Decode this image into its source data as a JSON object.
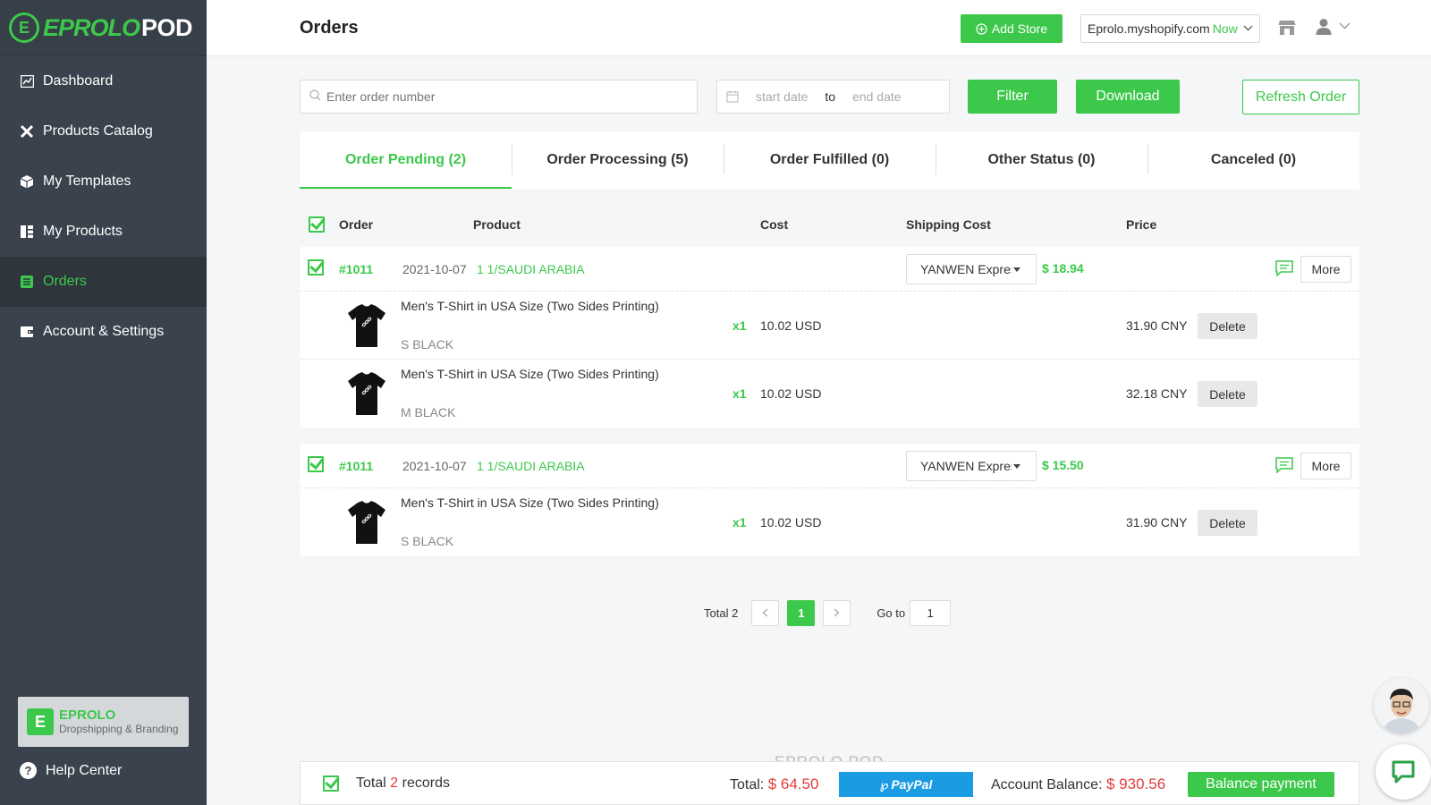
{
  "brand": {
    "logo_main": "EPROLO",
    "logo_pod": "POD",
    "box_name": "EPROLO",
    "box_sub": "Dropshipping & Branding",
    "accent": "#3cc84a"
  },
  "sidebar": {
    "items": [
      {
        "label": "Dashboard",
        "icon": "chart-icon",
        "active": false
      },
      {
        "label": "Products Catalog",
        "icon": "tools-icon",
        "active": false
      },
      {
        "label": "My Templates",
        "icon": "box-icon",
        "active": false
      },
      {
        "label": "My Products",
        "icon": "grid-icon",
        "active": false
      },
      {
        "label": "Orders",
        "icon": "list-icon",
        "active": true
      },
      {
        "label": "Account & Settings",
        "icon": "wallet-icon",
        "active": false
      }
    ],
    "help": "Help Center"
  },
  "header": {
    "title": "Orders",
    "add_store": "Add Store",
    "store_name": "Eprolo.myshopify.com",
    "store_status": "Now"
  },
  "search": {
    "order_placeholder": "Enter order number",
    "start_placeholder": "start date",
    "to": "to",
    "end_placeholder": "end date",
    "filter": "Filter",
    "download": "Download",
    "refresh": "Refresh Order"
  },
  "tabs": [
    {
      "label": "Order Pending (2)",
      "active": true
    },
    {
      "label": "Order Processing (5)",
      "active": false
    },
    {
      "label": "Order Fulfilled (0)",
      "active": false
    },
    {
      "label": "Other Status (0)",
      "active": false
    },
    {
      "label": "Canceled (0)",
      "active": false
    }
  ],
  "table": {
    "headers": {
      "order": "Order",
      "product": "Product",
      "cost": "Cost",
      "shipping": "Shipping Cost",
      "price": "Price"
    }
  },
  "orders": [
    {
      "id": "#1011",
      "date": "2021-10-07",
      "country": "1 1/SAUDI ARABIA",
      "shipping_method": "YANWEN Express",
      "shipping_price": "$ 18.94",
      "more": "More",
      "items": [
        {
          "name": "Men's T-Shirt in USA Size (Two Sides Printing)",
          "variant": "S BLACK",
          "qty": "x1",
          "cost": "10.02 USD",
          "price": "31.90 CNY",
          "delete": "Delete"
        },
        {
          "name": "Men's T-Shirt in USA Size (Two Sides Printing)",
          "variant": "M BLACK",
          "qty": "x1",
          "cost": "10.02 USD",
          "price": "32.18 CNY",
          "delete": "Delete"
        }
      ]
    },
    {
      "id": "#1011",
      "date": "2021-10-07",
      "country": "1 1/SAUDI ARABIA",
      "shipping_method": "YANWEN Express",
      "shipping_price": "$ 15.50",
      "more": "More",
      "items": [
        {
          "name": "Men's T-Shirt in USA Size (Two Sides Printing)",
          "variant": "S BLACK",
          "qty": "x1",
          "cost": "10.02 USD",
          "price": "31.90 CNY",
          "delete": "Delete"
        }
      ]
    }
  ],
  "pagination": {
    "total": "Total 2",
    "current": "1",
    "goto_label": "Go to",
    "goto_value": "1"
  },
  "footer_faint": "EPROLO POD",
  "bottom": {
    "total_prefix": "Total",
    "total_count": "2",
    "total_suffix": "records",
    "sum_label": "Total:",
    "sum_value": "$ 64.50",
    "paypal": "PayPal",
    "balance_label": "Account Balance:",
    "balance_value": "$ 930.56",
    "balance_btn": "Balance payment"
  }
}
